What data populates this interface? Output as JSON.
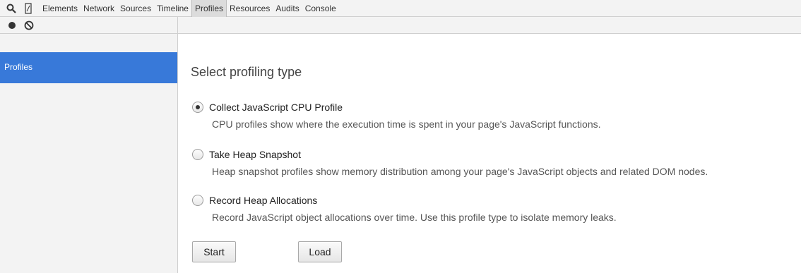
{
  "tabs": [
    "Elements",
    "Network",
    "Sources",
    "Timeline",
    "Profiles",
    "Resources",
    "Audits",
    "Console"
  ],
  "active_tab": "Profiles",
  "sidebar": {
    "item_label": "Profiles"
  },
  "main": {
    "title": "Select profiling type",
    "options": [
      {
        "label": "Collect JavaScript CPU Profile",
        "description": "CPU profiles show where the execution time is spent in your page's JavaScript functions.",
        "selected": true
      },
      {
        "label": "Take Heap Snapshot",
        "description": "Heap snapshot profiles show memory distribution among your page's JavaScript objects and related DOM nodes.",
        "selected": false
      },
      {
        "label": "Record Heap Allocations",
        "description": "Record JavaScript object allocations over time. Use this profile type to isolate memory leaks.",
        "selected": false
      }
    ],
    "start_label": "Start",
    "load_label": "Load"
  },
  "icons": {
    "search": "search-icon",
    "device": "device-mode-icon",
    "record": "record-icon",
    "clear": "clear-icon"
  },
  "colors": {
    "selected_sidebar": "#3879d9"
  }
}
